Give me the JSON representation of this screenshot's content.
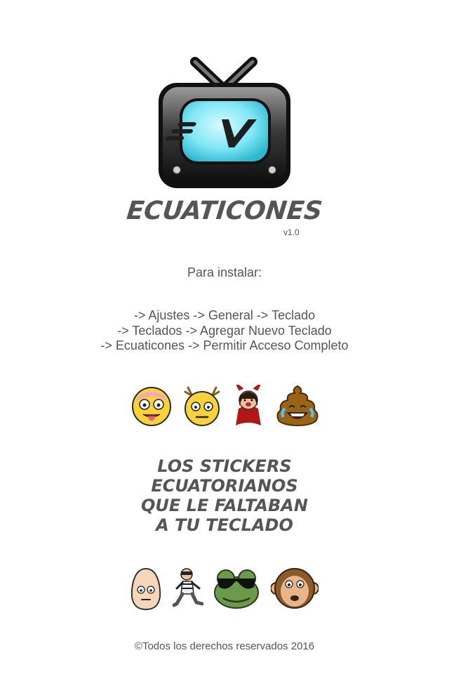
{
  "app": {
    "title": "ECUATICONES",
    "version": "v1.0",
    "logo_icon": "tv-logo-icon",
    "logo_text": "EV"
  },
  "install": {
    "heading": "Para instalar:",
    "steps": [
      "-> Ajustes -> General -> Teclado",
      "-> Teclados -> Agregar Nuevo Teclado",
      "-> Ecuaticones -> Permitir Acceso Completo"
    ]
  },
  "tagline": {
    "lines": [
      "LOS STICKERS",
      "ECUATORIANOS",
      "QUE LE FALTABAN",
      "A TU TECLADO"
    ]
  },
  "stickers_row1": [
    "tongue-face-icon",
    "antlers-face-icon",
    "devil-girl-icon",
    "laughing-poop-icon"
  ],
  "stickers_row2": [
    "egg-face-icon",
    "thief-running-icon",
    "cool-frog-icon",
    "monkey-face-icon"
  ],
  "footer": {
    "copyright": "©Todos los derechos reservados 2016"
  },
  "colors": {
    "text": "#555555",
    "screen": "#7fe6f5",
    "tv_body": "#1a1a1a"
  }
}
